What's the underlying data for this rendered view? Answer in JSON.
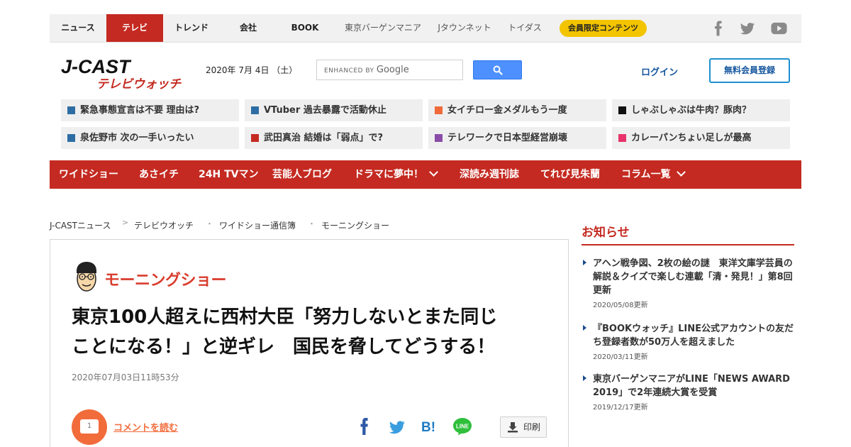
{
  "top_nav": {
    "items": [
      "ニュース",
      "テレビ",
      "トレンド",
      "会社",
      "BOOK"
    ],
    "sub_items": [
      "東京バーゲンマニア",
      "Jタウンネット",
      "トイダス"
    ],
    "member_badge": "会員限定コンテンツ",
    "social_icons": [
      "facebook-icon",
      "twitter-icon",
      "youtube-icon"
    ],
    "active_index": 1
  },
  "header": {
    "logo_main": "J-CAST",
    "logo_sub": "テレビウォッチ",
    "date": "2020年 7月 4日 （土）",
    "search": {
      "placeholder_small": "ENHANCED BY",
      "placeholder_brand": "Google",
      "button_icon": "search-icon"
    },
    "login": "ログイン",
    "register": "無料会員登録"
  },
  "topics": [
    {
      "label": "緊急事態宣言は不要 理由は?",
      "color": "#2e6da4"
    },
    {
      "label": "VTuber 過去暴露で活動休止",
      "color": "#2e6da4"
    },
    {
      "label": "女イチロー金メダルもう一度",
      "color": "#f06a3a"
    },
    {
      "label": "しゃぶしゃぶは牛肉？豚肉？",
      "color": "#111111"
    },
    {
      "label": "泉佐野市 次の一手いったい",
      "color": "#2e6da4"
    },
    {
      "label": "武田真治 結婚は「弱点」で?",
      "color": "#c42a21"
    },
    {
      "label": "テレワークで日本型経営崩壊",
      "color": "#8a4ca8"
    },
    {
      "label": "カレーパンちょい足しが最高",
      "color": "#e8336a"
    }
  ],
  "red_nav": {
    "items": [
      "ワイドショー",
      "あさイチ",
      "24H TVマン",
      "芸能人ブログ",
      "ドラマに夢中！",
      "深読み週刊誌",
      "てれび見朱蘭",
      "コラム一覧"
    ],
    "dropdown_indices": [
      4,
      7
    ]
  },
  "breadcrumb": [
    "J-CASTニュース",
    "テレビウオッチ",
    "ワイドショー通信簿",
    "モーニングショー"
  ],
  "article": {
    "series": "モーニングショー",
    "headline_line1": "東京100人超えに西村大臣「努力しないとまた同じ",
    "headline_line2": "ことになる！」と逆ギレ　国民を脅してどうする！",
    "date": "2020年07月03日11時53分",
    "comment_count": "1",
    "comment_link": "コメントを読む",
    "share_icons": [
      "facebook-share-icon",
      "twitter-share-icon",
      "hatena-bookmark-icon",
      "line-icon"
    ],
    "print_label": "印刷"
  },
  "sidebar": {
    "title": "お知らせ",
    "items": [
      {
        "text": "アヘン戦争図、2枚の絵の謎　東洋文庫学芸員の解説＆クイズで楽しむ連載「清・発見！」第8回更新",
        "date": "2020/05/08更新"
      },
      {
        "text": "『BOOKウォッチ』LINE公式アカウントの友だち登録者数が50万人を超えました",
        "date": "2020/03/11更新"
      },
      {
        "text": "東京バーゲンマニアがLINE「NEWS AWARD 2019」で2年連続大賞を受賞",
        "date": "2019/12/17更新"
      }
    ]
  },
  "colors": {
    "brand_red": "#c42a21",
    "accent_orange": "#f26c3b",
    "badge_yellow": "#f3c400",
    "link_blue": "#15569e"
  }
}
